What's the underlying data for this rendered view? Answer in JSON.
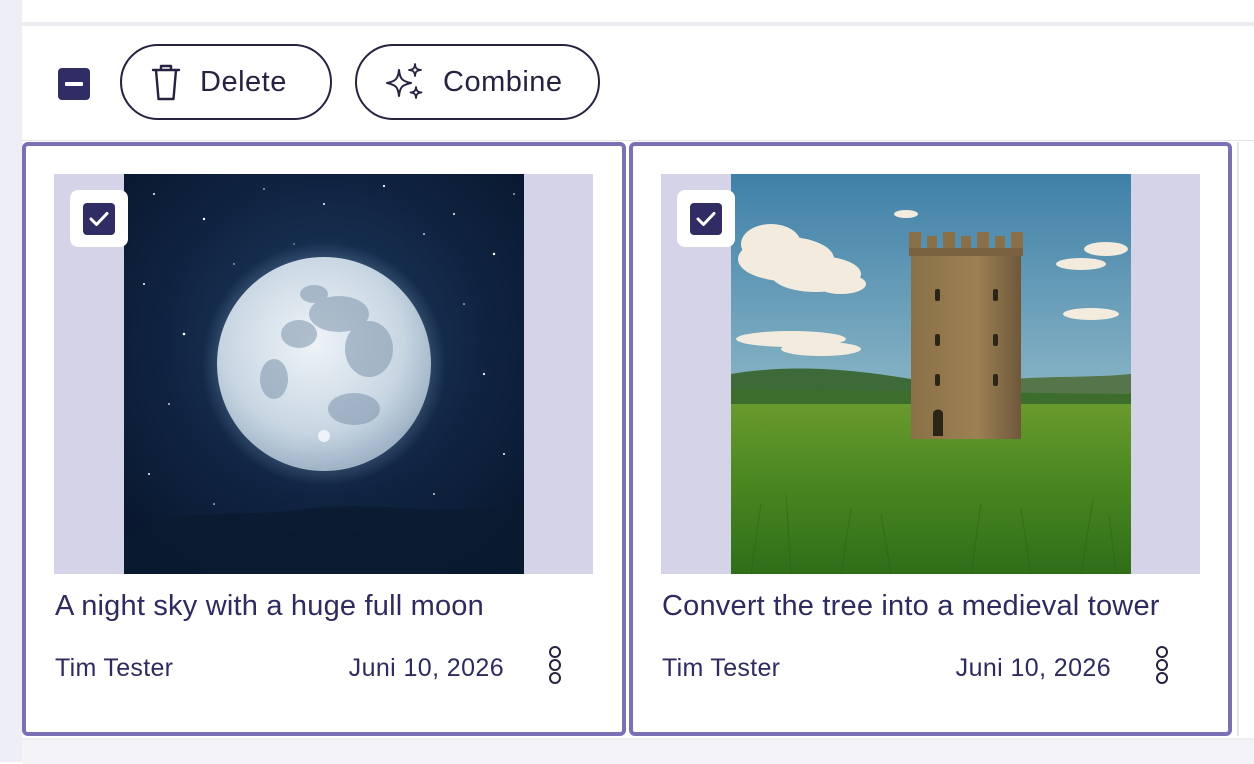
{
  "toolbar": {
    "delete_label": "Delete",
    "combine_label": "Combine"
  },
  "cards": [
    {
      "title": "A night sky with a huge full moon",
      "author": "Tim Tester",
      "date": "Juni 10, 2026",
      "selected": true
    },
    {
      "title": "Convert the tree into a medieval tower",
      "author": "Tim Tester",
      "date": "Juni 10, 2026",
      "selected": true
    }
  ],
  "colors": {
    "accent": "#2f2d63",
    "card_border": "#7a70b3",
    "thumb_bg": "#d4d3e7",
    "text": "#2e2b5f"
  }
}
